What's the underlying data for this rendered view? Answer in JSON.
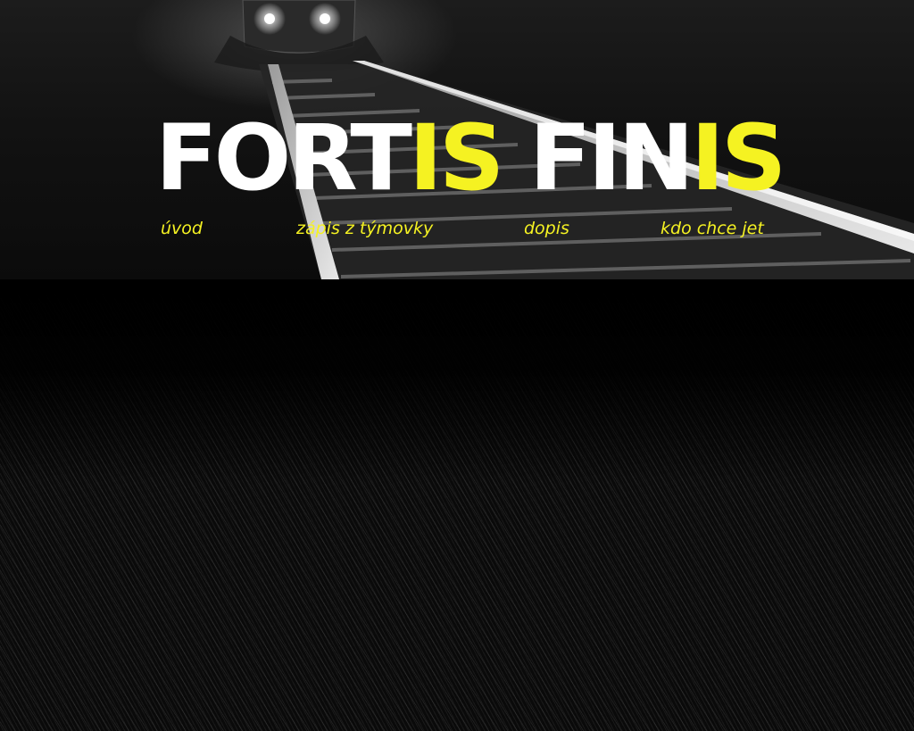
{
  "header": {
    "title_part1": "FORT",
    "title_part2": "IS",
    "title_part3": " FIN",
    "title_part4": "IS"
  },
  "nav": {
    "items": [
      {
        "label": "úvod"
      },
      {
        "label": "zápis z týmovky"
      },
      {
        "label": "dopis"
      },
      {
        "label": "kdo chce jet"
      }
    ]
  },
  "colors": {
    "accent": "#f5f222",
    "title": "#ffffff",
    "background": "#000000"
  }
}
